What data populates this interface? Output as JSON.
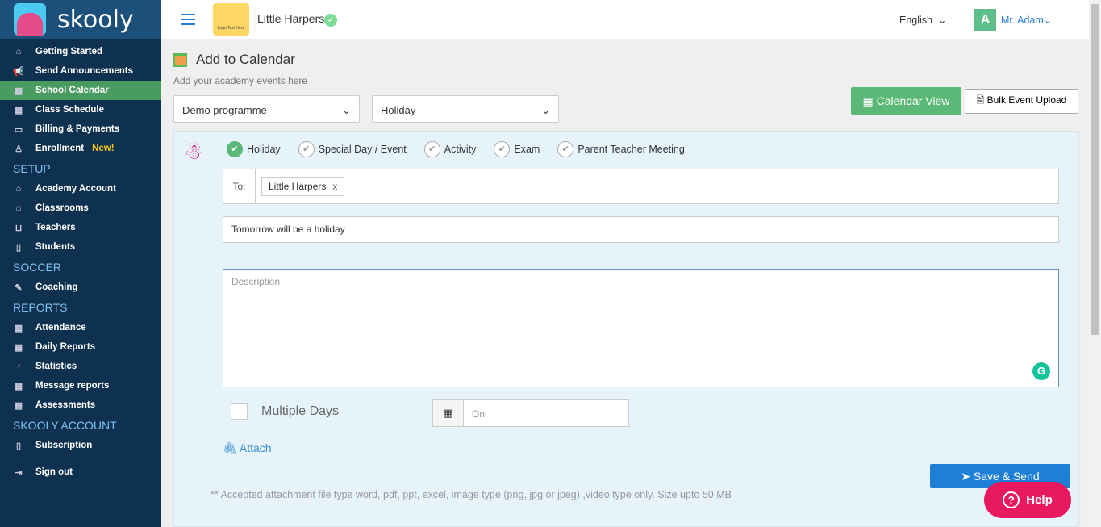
{
  "brand": "skooly",
  "sidebar": {
    "items": [
      {
        "label": "Getting Started",
        "icon": "⌂"
      },
      {
        "label": "Send Announcements",
        "icon": "📢"
      },
      {
        "label": "School Calendar",
        "icon": "▦",
        "active": true
      },
      {
        "label": "Class Schedule",
        "icon": "▦"
      },
      {
        "label": "Billing & Payments",
        "icon": "▭"
      },
      {
        "label": "Enrollment",
        "icon": "♙",
        "badge": "New!"
      }
    ],
    "setup_title": "SETUP",
    "setup": [
      {
        "label": "Academy Account",
        "icon": "⌂"
      },
      {
        "label": "Classrooms",
        "icon": "⌂"
      },
      {
        "label": "Teachers",
        "icon": "⊔"
      },
      {
        "label": "Students",
        "icon": "▯"
      }
    ],
    "soccer_title": "SOCCER",
    "soccer": [
      {
        "label": "Coaching",
        "icon": "✎"
      }
    ],
    "reports_title": "REPORTS",
    "reports": [
      {
        "label": "Attendance",
        "icon": "▦"
      },
      {
        "label": "Daily Reports",
        "icon": "▦"
      },
      {
        "label": "Statistics",
        "icon": "◔"
      },
      {
        "label": "Message reports",
        "icon": "▦"
      },
      {
        "label": "Assessments",
        "icon": "▦"
      }
    ],
    "account_title": "SKOOLY ACCOUNT",
    "account": [
      {
        "label": "Subscription",
        "icon": "▯"
      }
    ],
    "signout": "Sign out"
  },
  "header": {
    "school": "Little Harpers",
    "logo_text": "Logo Text Here",
    "language": "English",
    "avatar": "A",
    "user": "Mr. Adam"
  },
  "page": {
    "title": "Add to Calendar",
    "subtitle": "Add your academy events here",
    "programme": "Demo programme",
    "event_type": "Holiday",
    "calendar_view": "Calendar View",
    "bulk_upload": "Bulk Event Upload"
  },
  "form": {
    "types": [
      {
        "label": "Holiday",
        "checked": true
      },
      {
        "label": "Special Day / Event"
      },
      {
        "label": "Activity"
      },
      {
        "label": "Exam"
      },
      {
        "label": "Parent Teacher Meeting"
      }
    ],
    "to_label": "To:",
    "recipient": "Little Harpers",
    "remove": "x",
    "subject": "Tomorrow will be a holiday",
    "description_placeholder": "Description",
    "multiple_days": "Multiple Days",
    "date_placeholder": "On",
    "attach": "Attach",
    "save": "Save & Send",
    "note": "** Accepted attachment file type word, pdf, ppt, excel, image type (png, jpg or jpeg) ,video type only. Size upto 50 MB"
  },
  "help": "Help"
}
